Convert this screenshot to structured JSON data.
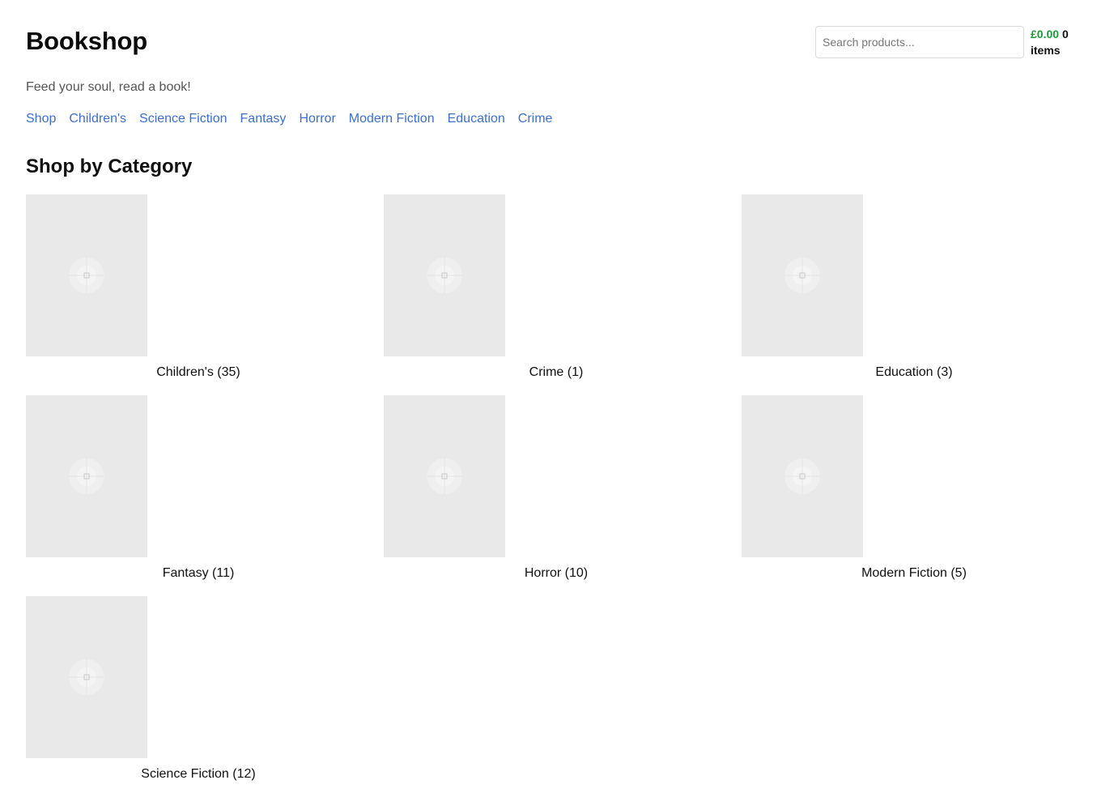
{
  "site": {
    "title": "Bookshop",
    "tagline": "Feed your soul, read a book!"
  },
  "search": {
    "placeholder": "Search products..."
  },
  "cart": {
    "total": "£0.00",
    "count": "0",
    "items_label": "items"
  },
  "nav": {
    "items": [
      {
        "label": "Shop"
      },
      {
        "label": "Children's"
      },
      {
        "label": "Science Fiction"
      },
      {
        "label": "Fantasy"
      },
      {
        "label": "Horror"
      },
      {
        "label": "Modern Fiction"
      },
      {
        "label": "Education"
      },
      {
        "label": "Crime"
      }
    ]
  },
  "categories": {
    "heading": "Shop by Category",
    "items": [
      {
        "label": "Children's (35)"
      },
      {
        "label": "Crime (1)"
      },
      {
        "label": "Education (3)"
      },
      {
        "label": "Fantasy (11)"
      },
      {
        "label": "Horror (10)"
      },
      {
        "label": "Modern Fiction (5)"
      },
      {
        "label": "Science Fiction (12)"
      }
    ]
  },
  "colors": {
    "link": "#3b6fd1",
    "price": "#1a9b3a",
    "placeholder_bg": "#e9e9e9"
  },
  "icons": {
    "cover_placeholder": "image-placeholder-icon"
  }
}
